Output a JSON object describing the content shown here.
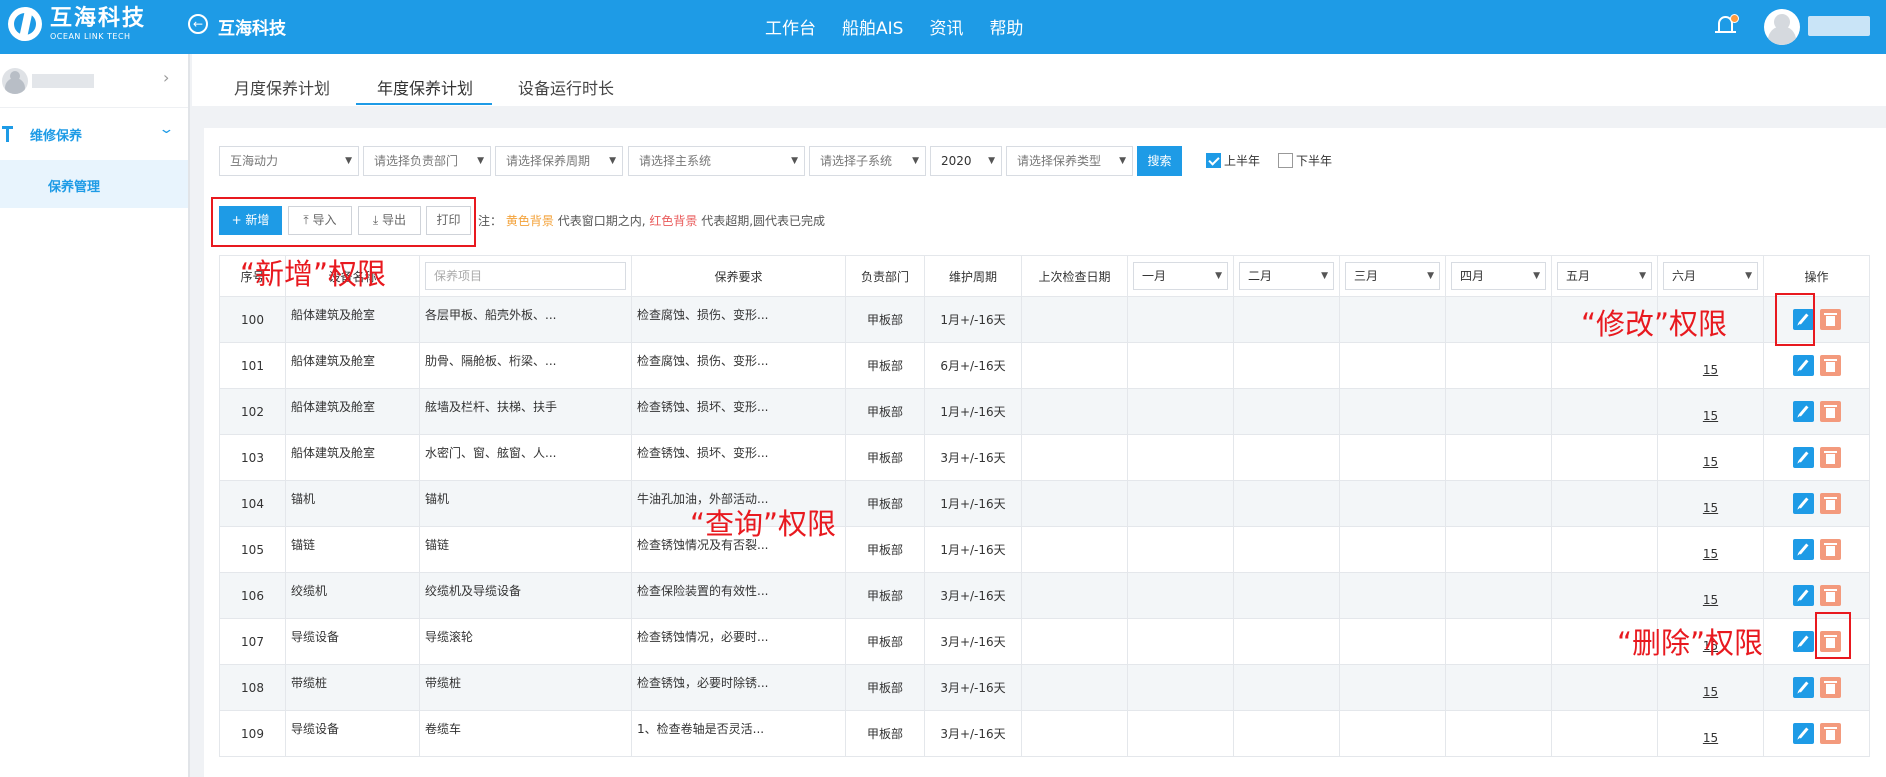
{
  "header": {
    "logo_cn": "互海科技",
    "logo_en": "OCEAN LINK TECH",
    "app_name": "互海科技",
    "nav": [
      "工作台",
      "船舶AIS",
      "资讯",
      "帮助"
    ]
  },
  "sidebar": {
    "group_label": "维修保养",
    "item_label": "保养管理"
  },
  "tabs": [
    "月度保养计划",
    "年度保养计划",
    "设备运行时长"
  ],
  "filters": {
    "ship": "互海动力",
    "dept": "请选择负责部门",
    "cycle": "请选择保养周期",
    "main_system": "请选择主系统",
    "sub_system": "请选择子系统",
    "year": "2020",
    "type": "请选择保养类型",
    "search": "搜索",
    "first_half": "上半年",
    "second_half": "下半年"
  },
  "actions": {
    "add": "+ 新增",
    "import": "导入",
    "export": "导出",
    "print": "打印"
  },
  "note": {
    "prefix": "注：",
    "yellow": "黄色背景",
    "yellow_desc": "代表窗口期之内,",
    "red": "红色背景",
    "red_desc": "代表超期,圆代表已完成"
  },
  "table": {
    "headers": {
      "no": "序号",
      "equipment": "设备名称",
      "item_placeholder": "保养项目",
      "requirement": "保养要求",
      "dept": "负责部门",
      "cycle": "维护周期",
      "last_check": "上次检查日期",
      "months": [
        "一月",
        "二月",
        "三月",
        "四月",
        "五月",
        "六月"
      ],
      "ops": "操作"
    },
    "rows": [
      {
        "no": "100",
        "equipment": "船体建筑及舱室",
        "item": "各层甲板、船壳外板、...",
        "requirement": "检查腐蚀、损伤、变形...",
        "dept": "甲板部",
        "cycle": "1月+/-16天",
        "jun": ""
      },
      {
        "no": "101",
        "equipment": "船体建筑及舱室",
        "item": "肋骨、隔舱板、桁梁、...",
        "requirement": "检查腐蚀、损伤、变形...",
        "dept": "甲板部",
        "cycle": "6月+/-16天",
        "jun": "15"
      },
      {
        "no": "102",
        "equipment": "船体建筑及舱室",
        "item": "舷墙及栏杆、扶梯、扶手",
        "requirement": "检查锈蚀、损坏、变形...",
        "dept": "甲板部",
        "cycle": "1月+/-16天",
        "jun": "15"
      },
      {
        "no": "103",
        "equipment": "船体建筑及舱室",
        "item": "水密门、窗、舷窗、人...",
        "requirement": "检查锈蚀、损坏、变形...",
        "dept": "甲板部",
        "cycle": "3月+/-16天",
        "jun": "15"
      },
      {
        "no": "104",
        "equipment": "锚机",
        "item": "锚机",
        "requirement": "牛油孔加油，外部活动...",
        "dept": "甲板部",
        "cycle": "1月+/-16天",
        "jun": "15"
      },
      {
        "no": "105",
        "equipment": "锚链",
        "item": "锚链",
        "requirement": "检查锈蚀情况及有否裂...",
        "dept": "甲板部",
        "cycle": "1月+/-16天",
        "jun": "15"
      },
      {
        "no": "106",
        "equipment": "绞缆机",
        "item": "绞缆机及导缆设备",
        "requirement": "检查保险装置的有效性...",
        "dept": "甲板部",
        "cycle": "3月+/-16天",
        "jun": "15"
      },
      {
        "no": "107",
        "equipment": "导缆设备",
        "item": "导缆滚轮",
        "requirement": "检查锈蚀情况，必要时...",
        "dept": "甲板部",
        "cycle": "3月+/-16天",
        "jun": "15"
      },
      {
        "no": "108",
        "equipment": "带缆桩",
        "item": "带缆桩",
        "requirement": "检查锈蚀，必要时除锈...",
        "dept": "甲板部",
        "cycle": "3月+/-16天",
        "jun": "15"
      },
      {
        "no": "109",
        "equipment": "导缆设备",
        "item": "卷缆车",
        "requirement": "1、检查卷轴是否灵活...",
        "dept": "甲板部",
        "cycle": "3月+/-16天",
        "jun": "15"
      }
    ]
  },
  "annotations": {
    "add_perm": "“新增”权限",
    "query_perm": "“查询”权限",
    "edit_perm": "“修改”权限",
    "delete_perm": "“删除”权限"
  },
  "colors": {
    "primary": "#1e9be6",
    "annotation": "#e8191f",
    "delete_btn": "#f39a7d",
    "note_yellow": "#f3a23a",
    "note_red": "#e95b5b"
  }
}
